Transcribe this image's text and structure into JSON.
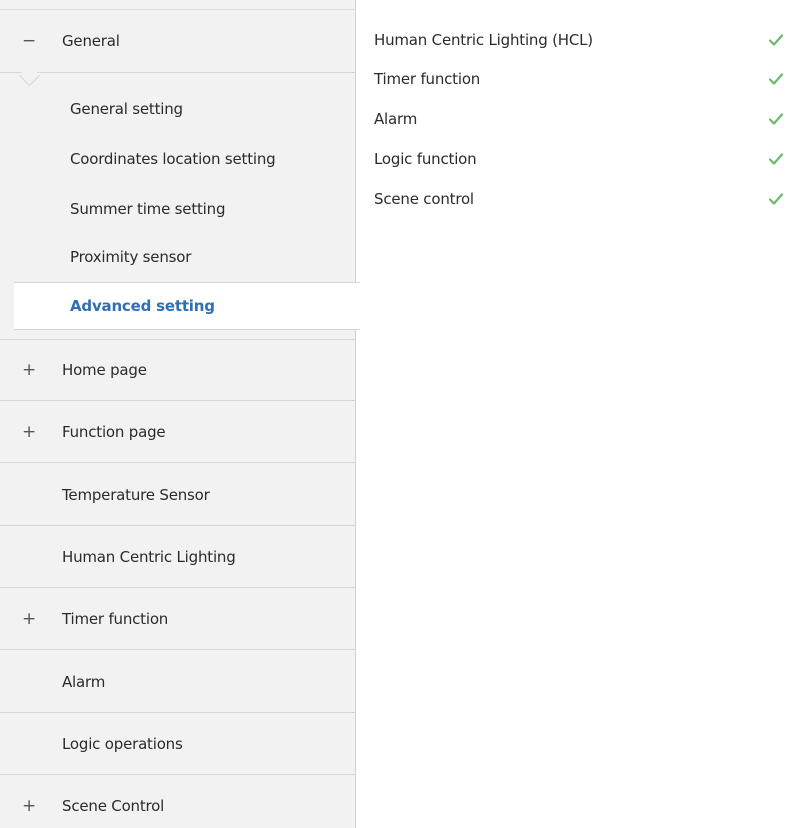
{
  "sidebar": {
    "general": {
      "sign": "−",
      "label": "General"
    },
    "sub_items": [
      {
        "label": "General setting"
      },
      {
        "label": "Coordinates location setting"
      },
      {
        "label": "Summer time setting"
      },
      {
        "label": "Proximity sensor"
      },
      {
        "label": "Advanced setting",
        "active": true
      }
    ],
    "items": [
      {
        "sign": "+",
        "label": "Home page"
      },
      {
        "sign": "+",
        "label": "Function page"
      },
      {
        "sign": "",
        "label": "Temperature Sensor"
      },
      {
        "sign": "",
        "label": "Human Centric Lighting"
      },
      {
        "sign": "+",
        "label": "Timer function"
      },
      {
        "sign": "",
        "label": "Alarm"
      },
      {
        "sign": "",
        "label": "Logic operations"
      },
      {
        "sign": "+",
        "label": "Scene Control"
      }
    ]
  },
  "main": {
    "params": [
      {
        "label": "Human Centric Lighting (HCL)",
        "checked": true
      },
      {
        "label": "Timer function",
        "checked": true
      },
      {
        "label": "Alarm",
        "checked": true
      },
      {
        "label": "Logic function",
        "checked": true
      },
      {
        "label": "Scene control",
        "checked": true
      }
    ]
  },
  "colors": {
    "active_text": "#2f6fb3",
    "check": "#6bb86b",
    "sidebar_bg": "#f2f2f2"
  }
}
